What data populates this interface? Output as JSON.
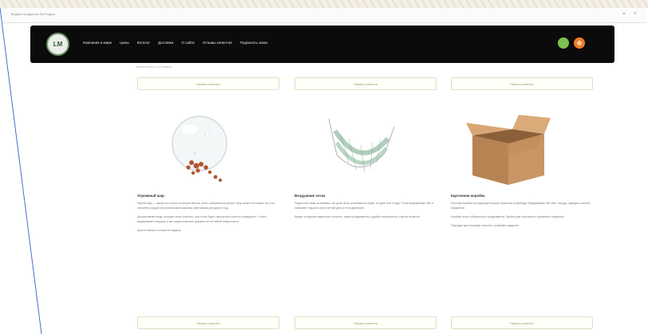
{
  "browser": {
    "title": "Модуль продуктов Ли-Студио",
    "pin_label": "⌖",
    "close_label": "×"
  },
  "nav": {
    "logo_text": "LM",
    "items": [
      {
        "label": "Компания в мире"
      },
      {
        "label": "Цены"
      },
      {
        "label": "Каталог"
      },
      {
        "label": "Доставка"
      },
      {
        "label": "О сайте"
      },
      {
        "label": "Отзывы клиентов"
      },
      {
        "label": "Подписать заказ"
      }
    ]
  },
  "top": {
    "cutoff_text": "можно клиент в тот момент."
  },
  "buttons": {
    "label": "Нажать клиента"
  },
  "cards": [
    {
      "title": "Огромный шар",
      "paragraphs": [
        "Пустой шар — сфера из стекла, в которой мелочь легко собирается в центре. Шар можно поставить на стол, наполнить водой или использовать как вазу, светильник для дома и сад.",
        "Декоративная вещь, которую легко очистить, она точно будет смотреться стильно и аккуратно. Стекло выдерживает нагрузку, а вес шара позволяет держать её на любой поверхности.",
        "Купите сейчас и получите подарок."
      ]
    },
    {
      "title": "Воздушная сетка",
      "paragraphs": [
        "Подвесной гамак из верёвки, который легко установить в парке, на даче или в саду. Сетка выдерживает вес и позволяет отдыхать весь летний день в тени деревьев.",
        "Каркас из дерева закрепляет полотно, гамак складывается и удобно переносится с места на место."
      ]
    },
    {
      "title": "Картонная коробка",
      "paragraphs": [
        "Плотная коробка из гофрокартона для хранения и переезда. Выдерживает вес книг, посуды, одежды и мелких предметов.",
        "Коробка легко собирается и складывается. Удобна для переноски и хранения в кладовой.",
        "Подходит для отправки посылок и упаковки подарков."
      ]
    }
  ]
}
